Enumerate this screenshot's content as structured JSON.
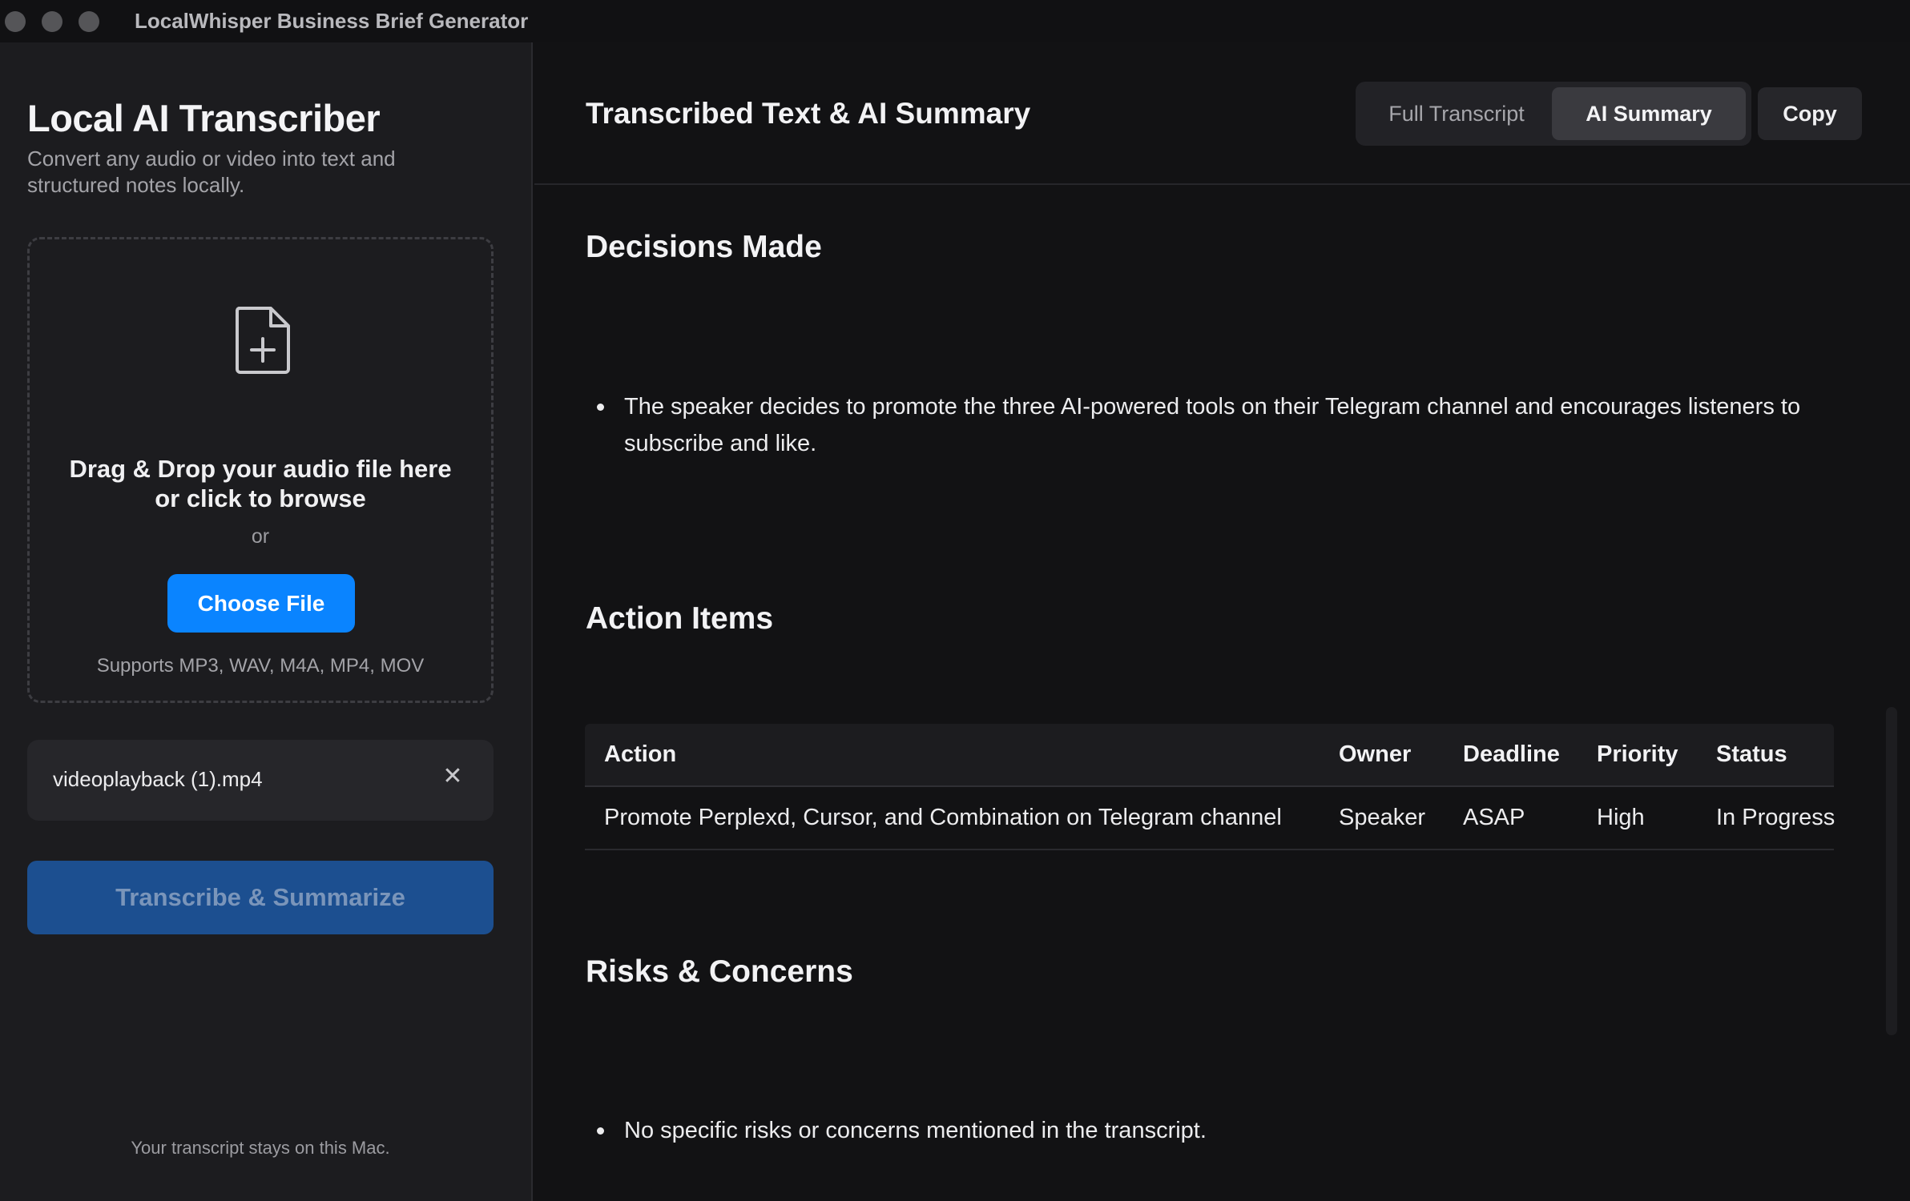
{
  "window": {
    "title": "LocalWhisper Business Brief Generator"
  },
  "sidebar": {
    "title": "Local AI Transcriber",
    "subtitle": "Convert any audio or video into text and structured notes locally.",
    "dropzone": {
      "icon": "file-add-icon",
      "line1": "Drag & Drop your audio file here",
      "line2": "or click to browse",
      "or": "or",
      "choose_label": "Choose File",
      "supports": "Supports MP3, WAV, M4A, MP4, MOV"
    },
    "file": {
      "name": "videoplayback (1).mp4",
      "close": "✕"
    },
    "transcribe_label": "Transcribe & Summarize",
    "privacy": "Your transcript stays on this Mac."
  },
  "main": {
    "title": "Transcribed Text & AI Summary",
    "tabs": [
      {
        "label": "Full Transcript",
        "selected": false
      },
      {
        "label": "AI Summary",
        "selected": true
      }
    ],
    "copy_label": "Copy",
    "decisions": {
      "heading": "Decisions Made",
      "items": [
        "The speaker decides to promote the three AI-powered tools on their Telegram channel and encourages listeners to subscribe and like."
      ]
    },
    "actions": {
      "heading": "Action Items",
      "columns": [
        "Action",
        "Owner",
        "Deadline",
        "Priority",
        "Status"
      ],
      "rows": [
        [
          "Promote Perplexd, Cursor, and Combination on Telegram channel",
          "Speaker",
          "ASAP",
          "High",
          "In Progress"
        ]
      ]
    },
    "risks": {
      "heading": "Risks & Concerns",
      "items": [
        "No specific risks or concerns mentioned in the transcript."
      ]
    }
  },
  "colors": {
    "accent": "#0a84ff",
    "primary_button": "#1c4f90",
    "background": "#121214",
    "sidebar": "#1c1c1f"
  }
}
